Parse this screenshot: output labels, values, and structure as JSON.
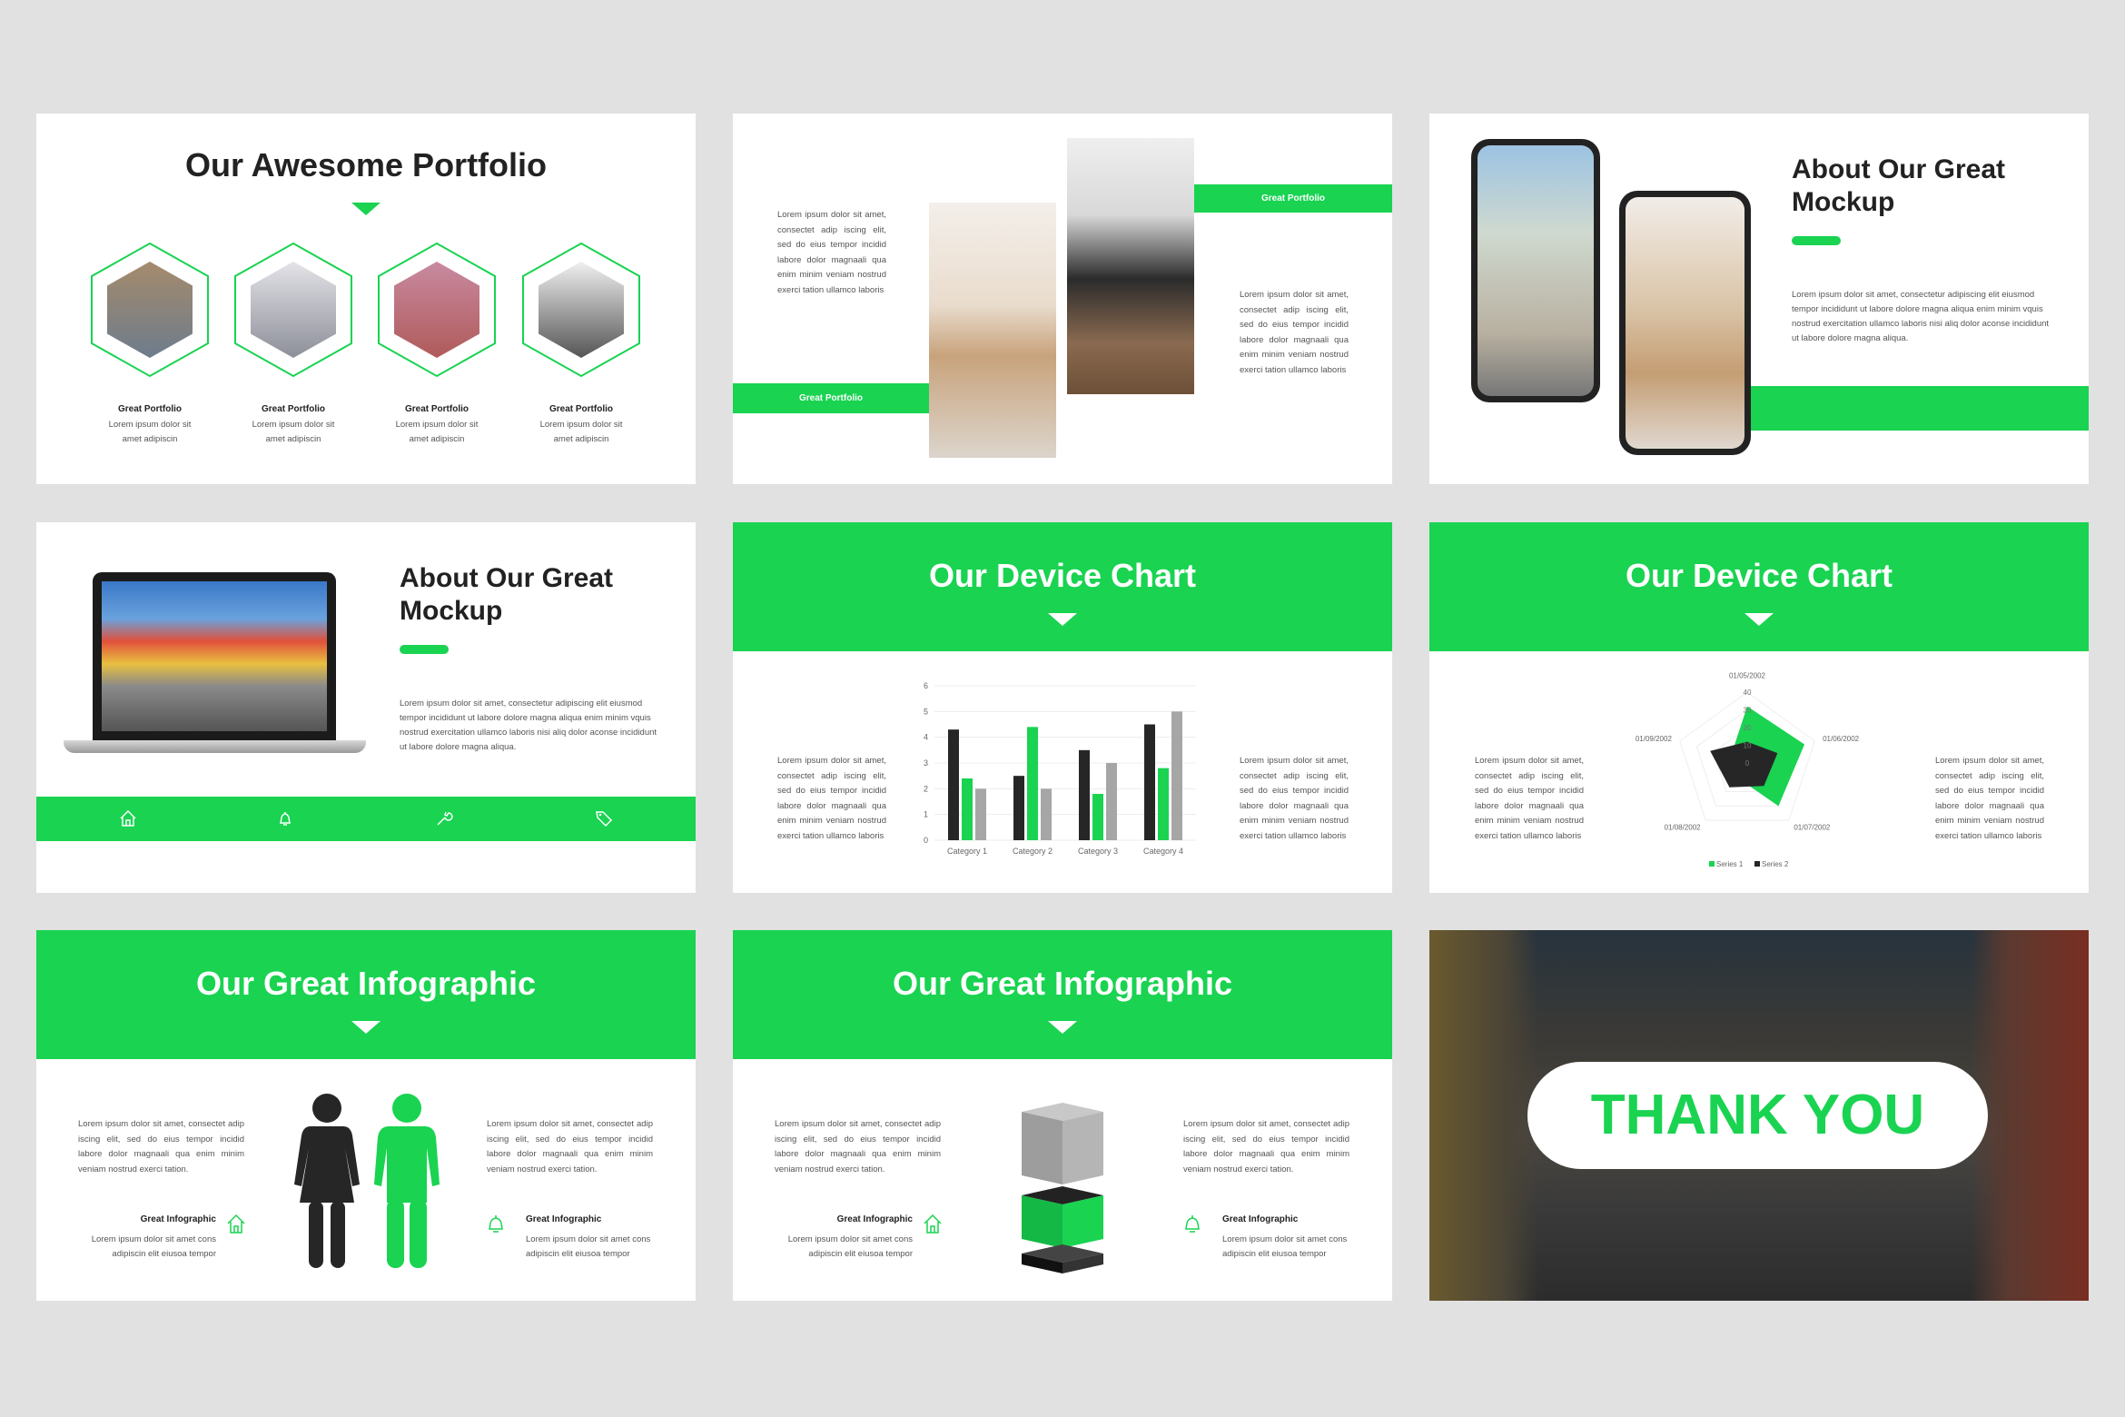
{
  "accent_color": "#19d351",
  "slide1": {
    "title": "Our Awesome Portfolio",
    "items": [
      {
        "label": "Great Portfolio",
        "desc1": "Lorem ipsum dolor sit",
        "desc2": "amet adipiscin"
      },
      {
        "label": "Great Portfolio",
        "desc1": "Lorem ipsum dolor sit",
        "desc2": "amet adipiscin"
      },
      {
        "label": "Great Portfolio",
        "desc1": "Lorem ipsum dolor sit",
        "desc2": "amet adipiscin"
      },
      {
        "label": "Great Portfolio",
        "desc1": "Lorem ipsum dolor sit",
        "desc2": "amet adipiscin"
      }
    ]
  },
  "slide2": {
    "left_text": "Lorem ipsum dolor sit amet, consectet adip iscing elit, sed do eius tempor incidid labore dolor magnaali qua enim minim veniam nostrud exerci tation ullamco laboris",
    "right_text": "Lorem ipsum dolor sit amet, consectet adip iscing elit, sed do eius tempor incidid labore dolor magnaali qua enim minim veniam nostrud exerci tation ullamco laboris",
    "banner_left": "Great Portfolio",
    "banner_right": "Great Portfolio"
  },
  "slide3": {
    "title_line1": "About Our Great",
    "title_line2": "Mockup",
    "text": "Lorem ipsum dolor sit amet, consectetur adipiscing elit eiusmod tempor incididunt ut labore dolore magna aliqua enim minim vquis nostrud exercitation ullamco laboris nisi aliq dolor aconse incididunt ut labore dolore magna aliqua."
  },
  "slide4": {
    "title_line1": "About Our Great",
    "title_line2": "Mockup",
    "text": "Lorem ipsum dolor sit amet, consectetur adipiscing elit eiusmod tempor incididunt ut labore dolore magna aliqua enim minim vquis nostrud exercitation ullamco laboris nisi aliq dolor aconse incididunt ut labore dolore magna aliqua.",
    "icons": [
      "home-icon",
      "bell-icon",
      "wrench-icon",
      "tag-icon"
    ]
  },
  "slide5": {
    "title": "Our Device Chart",
    "left_text": "Lorem ipsum dolor sit amet, consectet adip iscing elit, sed do eius tempor incidid labore dolor magnaali qua enim minim veniam nostrud exerci tation ullamco laboris",
    "right_text": "Lorem ipsum dolor sit amet, consectet adip iscing elit, sed do eius tempor incidid labore dolor magnaali qua enim minim veniam nostrud exerci tation ullamco laboris"
  },
  "slide6": {
    "title": "Our Device Chart",
    "left_text": "Lorem ipsum dolor sit amet, consectet adip iscing elit, sed do eius tempor incidid labore dolor magnaali qua enim minim veniam nostrud exerci tation ullamco laboris",
    "right_text": "Lorem ipsum dolor sit amet, consectet adip iscing elit, sed do eius tempor incidid labore dolor magnaali qua enim minim veniam nostrud exerci tation ullamco laboris"
  },
  "slide7": {
    "title": "Our Great Infographic",
    "left_text": "Lorem ipsum dolor sit amet, consectet adip iscing elit, sed do eius tempor incidid labore dolor magnaali qua enim minim veniam nostrud exerci tation.",
    "right_text": "Lorem ipsum dolor sit amet, consectet adip iscing elit, sed do eius tempor incidid labore dolor magnaali qua enim minim veniam nostrud exerci tation.",
    "left_label": "Great Infographic",
    "left_desc1": "Lorem ipsum dolor sit amet cons",
    "left_desc2": "adipiscin elit eiusoa tempor",
    "right_label": "Great Infographic",
    "right_desc1": "Lorem ipsum dolor sit amet cons",
    "right_desc2": "adipiscin elit eiusoa tempor"
  },
  "slide8": {
    "title": "Our Great Infographic",
    "left_text": "Lorem ipsum dolor sit amet, consectet adip iscing elit, sed do eius tempor incidid labore dolor magnaali qua enim minim veniam nostrud exerci tation.",
    "right_text": "Lorem ipsum dolor sit amet, consectet adip iscing elit, sed do eius tempor incidid labore dolor magnaali qua enim minim veniam nostrud exerci tation.",
    "left_label": "Great Infographic",
    "left_desc1": "Lorem ipsum dolor sit amet cons",
    "left_desc2": "adipiscin elit eiusoa tempor",
    "right_label": "Great Infographic",
    "right_desc1": "Lorem ipsum dolor sit amet cons",
    "right_desc2": "adipiscin elit eiusoa tempor"
  },
  "slide9": {
    "text": "THANK YOU"
  },
  "chart_data": [
    {
      "type": "bar",
      "categories": [
        "Category 1",
        "Category 2",
        "Category 3",
        "Category 4"
      ],
      "series": [
        {
          "values": [
            4.3,
            2.5,
            3.5,
            4.5
          ],
          "color": "#262626"
        },
        {
          "values": [
            2.4,
            4.4,
            1.8,
            2.8
          ],
          "color": "#19d351"
        },
        {
          "values": [
            2,
            2,
            3,
            5
          ],
          "color": "#a6a6a6"
        }
      ],
      "ylim": [
        0,
        6
      ],
      "yticks": [
        "0",
        "1",
        "2",
        "3",
        "4",
        "5",
        "6"
      ],
      "grid": true
    },
    {
      "type": "radar",
      "categories": [
        "01/05/2002",
        "01/06/2002",
        "01/07/2002",
        "01/08/2002",
        "01/09/2002"
      ],
      "series": [
        {
          "name": "Series 1",
          "values": [
            32,
            34,
            30,
            10,
            10
          ],
          "color": "#19d351"
        },
        {
          "name": "Series 2",
          "values": [
            12,
            18,
            16,
            17,
            22
          ],
          "color": "#262626"
        }
      ],
      "rlim": [
        0,
        40
      ],
      "rticks": [
        "0",
        "10",
        "20",
        "30",
        "40"
      ],
      "legend": "bottom"
    }
  ]
}
